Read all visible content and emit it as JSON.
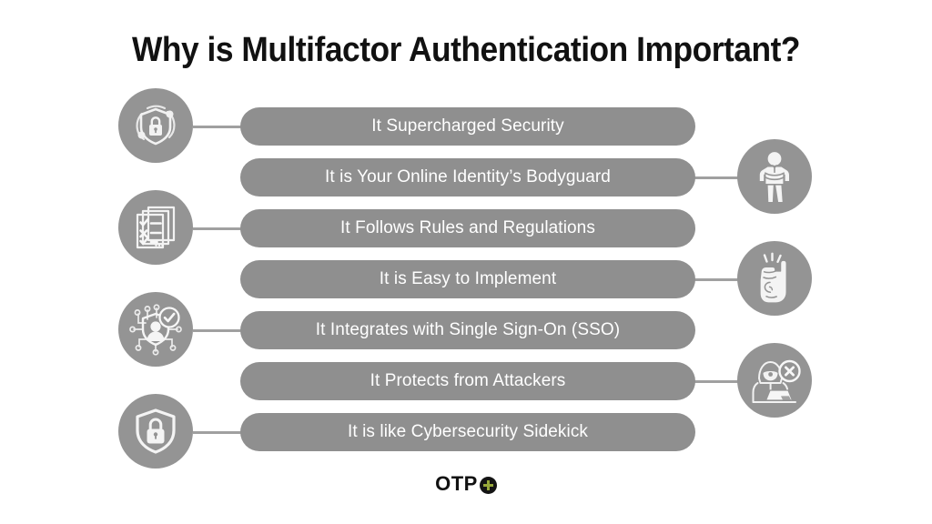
{
  "page": {
    "title": "Why is Multifactor Authentication Important?",
    "background_color": "#ffffff",
    "pill_color": "#8f8f8f",
    "pill_text_color": "#ffffff",
    "circle_color": "#949494",
    "connector_color": "#a0a0a0",
    "title_color": "#111111"
  },
  "benefits": [
    {
      "id": 1,
      "label": "It Supercharged Security"
    },
    {
      "id": 2,
      "label": "It is Your Online Identity’s Bodyguard"
    },
    {
      "id": 3,
      "label": "It Follows Rules and Regulations"
    },
    {
      "id": 4,
      "label": "It is Easy to Implement"
    },
    {
      "id": 5,
      "label": "It Integrates with Single Sign-On (SSO)"
    },
    {
      "id": 6,
      "label": "It Protects from Attackers"
    },
    {
      "id": 7,
      "label": "It is like Cybersecurity Sidekick"
    }
  ],
  "left_icons": [
    {
      "name": "shield-lock-network-icon",
      "connects_to_benefit": 1
    },
    {
      "name": "checklist-documents-icon",
      "connects_to_benefit": 3
    },
    {
      "name": "user-shield-circuit-check-icon",
      "connects_to_benefit": 5
    },
    {
      "name": "shield-padlock-icon",
      "connects_to_benefit": 7
    }
  ],
  "right_icons": [
    {
      "name": "bodyguard-person-icon",
      "connects_to_benefit": 2
    },
    {
      "name": "snapping-fingers-hand-icon",
      "connects_to_benefit": 4
    },
    {
      "name": "hacker-laptop-blocked-icon",
      "connects_to_benefit": 6
    }
  ],
  "logo": {
    "text": "OTP",
    "mark_name": "plus-circle-mark",
    "mark_color": "#97a83a",
    "mark_background": "#141414"
  }
}
